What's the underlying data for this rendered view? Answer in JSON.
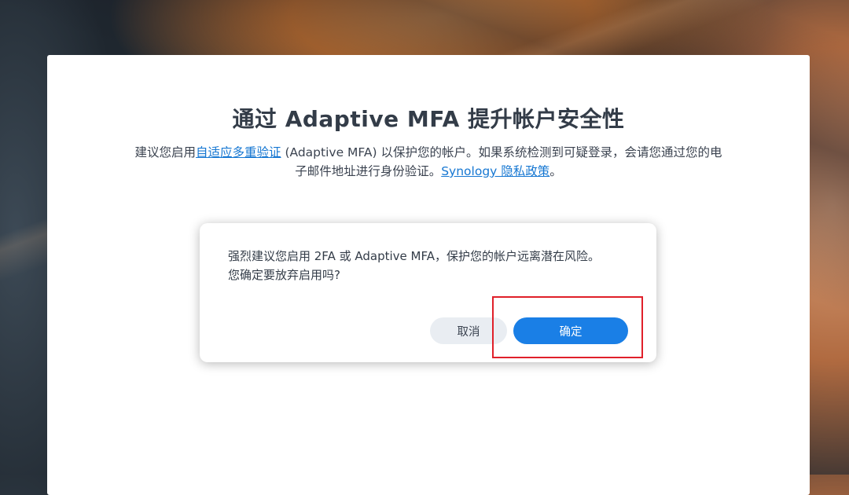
{
  "page": {
    "title": "通过 Adaptive MFA 提升帐户安全性",
    "description": {
      "part1": "建议您启用",
      "link_mfa": "自适应多重验证",
      "part2": " (Adaptive MFA) 以保护您的帐户。如果系统检测到可疑登录，会请您通过您的电子邮件地址进行身份验证。",
      "link_privacy": "Synology 隐私政策",
      "part3": "。"
    }
  },
  "dialog": {
    "message_line1": "强烈建议您启用 2FA 或 Adaptive MFA，保护您的帐户远离潜在风险。",
    "message_line2": "您确定要放弃启用吗?",
    "cancel_label": "取消",
    "confirm_label": "确定"
  },
  "colors": {
    "accent": "#1a7fe6",
    "link": "#1677d2",
    "highlight_box": "#e0202a"
  }
}
